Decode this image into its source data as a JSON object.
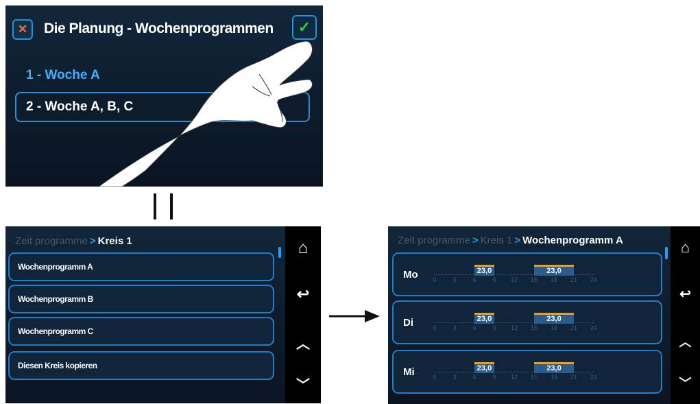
{
  "panel1": {
    "close_icon": "close-icon",
    "confirm_icon": "check-icon",
    "title": "Die Planung - Wochenprogrammen",
    "options": [
      "1 - Woche A",
      "2 - Woche A, B, C"
    ]
  },
  "equals_sign": "=",
  "panel2": {
    "breadcrumb": {
      "root": "Zeit programme",
      "current": "Kreis 1"
    },
    "items": [
      "Wochenprogramm A",
      "Wochenprogramm B",
      "Wochenprogramm C",
      "Diesen Kreis kopieren"
    ],
    "sidebar_icons": [
      "home-icon",
      "back-icon",
      "chevron-up-icon",
      "chevron-down-icon"
    ]
  },
  "panel3": {
    "breadcrumb": {
      "root": "Zeit programme",
      "middle": "Kreis 1",
      "current": "Wochenprogramm A"
    },
    "axis_ticks": [
      "0",
      "3",
      "6",
      "9",
      "12",
      "15",
      "18",
      "21",
      "24"
    ],
    "days": [
      {
        "label": "Mo",
        "periods": [
          {
            "start": 6,
            "end": 9,
            "value": "23,0"
          },
          {
            "start": 15,
            "end": 21,
            "value": "23,0"
          }
        ]
      },
      {
        "label": "Di",
        "periods": [
          {
            "start": 6,
            "end": 9,
            "value": "23,0"
          },
          {
            "start": 15,
            "end": 21,
            "value": "23,0"
          }
        ]
      },
      {
        "label": "Mi",
        "periods": [
          {
            "start": 6,
            "end": 9,
            "value": "23,0"
          },
          {
            "start": 15,
            "end": 21,
            "value": "23,0"
          }
        ]
      }
    ],
    "sidebar_icons": [
      "home-icon",
      "back-icon",
      "chevron-up-icon",
      "chevron-down-icon"
    ]
  },
  "colors": {
    "accent": "#2d9cf0",
    "orange": "#f39c12",
    "check_green": "#2ecc40",
    "panel_bg": "#10243a"
  }
}
